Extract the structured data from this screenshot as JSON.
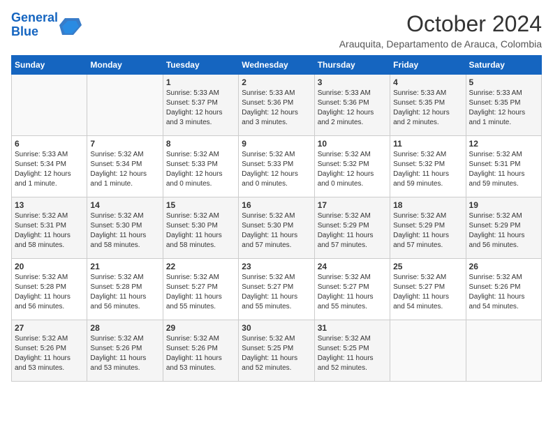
{
  "header": {
    "logo_text_general": "General",
    "logo_text_blue": "Blue",
    "month": "October 2024",
    "location": "Arauquita, Departamento de Arauca, Colombia"
  },
  "weekdays": [
    "Sunday",
    "Monday",
    "Tuesday",
    "Wednesday",
    "Thursday",
    "Friday",
    "Saturday"
  ],
  "weeks": [
    [
      {
        "day": "",
        "info": ""
      },
      {
        "day": "",
        "info": ""
      },
      {
        "day": "1",
        "info": "Sunrise: 5:33 AM\nSunset: 5:37 PM\nDaylight: 12 hours\nand 3 minutes."
      },
      {
        "day": "2",
        "info": "Sunrise: 5:33 AM\nSunset: 5:36 PM\nDaylight: 12 hours\nand 3 minutes."
      },
      {
        "day": "3",
        "info": "Sunrise: 5:33 AM\nSunset: 5:36 PM\nDaylight: 12 hours\nand 2 minutes."
      },
      {
        "day": "4",
        "info": "Sunrise: 5:33 AM\nSunset: 5:35 PM\nDaylight: 12 hours\nand 2 minutes."
      },
      {
        "day": "5",
        "info": "Sunrise: 5:33 AM\nSunset: 5:35 PM\nDaylight: 12 hours\nand 1 minute."
      }
    ],
    [
      {
        "day": "6",
        "info": "Sunrise: 5:33 AM\nSunset: 5:34 PM\nDaylight: 12 hours\nand 1 minute."
      },
      {
        "day": "7",
        "info": "Sunrise: 5:32 AM\nSunset: 5:34 PM\nDaylight: 12 hours\nand 1 minute."
      },
      {
        "day": "8",
        "info": "Sunrise: 5:32 AM\nSunset: 5:33 PM\nDaylight: 12 hours\nand 0 minutes."
      },
      {
        "day": "9",
        "info": "Sunrise: 5:32 AM\nSunset: 5:33 PM\nDaylight: 12 hours\nand 0 minutes."
      },
      {
        "day": "10",
        "info": "Sunrise: 5:32 AM\nSunset: 5:32 PM\nDaylight: 12 hours\nand 0 minutes."
      },
      {
        "day": "11",
        "info": "Sunrise: 5:32 AM\nSunset: 5:32 PM\nDaylight: 11 hours\nand 59 minutes."
      },
      {
        "day": "12",
        "info": "Sunrise: 5:32 AM\nSunset: 5:31 PM\nDaylight: 11 hours\nand 59 minutes."
      }
    ],
    [
      {
        "day": "13",
        "info": "Sunrise: 5:32 AM\nSunset: 5:31 PM\nDaylight: 11 hours\nand 58 minutes."
      },
      {
        "day": "14",
        "info": "Sunrise: 5:32 AM\nSunset: 5:30 PM\nDaylight: 11 hours\nand 58 minutes."
      },
      {
        "day": "15",
        "info": "Sunrise: 5:32 AM\nSunset: 5:30 PM\nDaylight: 11 hours\nand 58 minutes."
      },
      {
        "day": "16",
        "info": "Sunrise: 5:32 AM\nSunset: 5:30 PM\nDaylight: 11 hours\nand 57 minutes."
      },
      {
        "day": "17",
        "info": "Sunrise: 5:32 AM\nSunset: 5:29 PM\nDaylight: 11 hours\nand 57 minutes."
      },
      {
        "day": "18",
        "info": "Sunrise: 5:32 AM\nSunset: 5:29 PM\nDaylight: 11 hours\nand 57 minutes."
      },
      {
        "day": "19",
        "info": "Sunrise: 5:32 AM\nSunset: 5:29 PM\nDaylight: 11 hours\nand 56 minutes."
      }
    ],
    [
      {
        "day": "20",
        "info": "Sunrise: 5:32 AM\nSunset: 5:28 PM\nDaylight: 11 hours\nand 56 minutes."
      },
      {
        "day": "21",
        "info": "Sunrise: 5:32 AM\nSunset: 5:28 PM\nDaylight: 11 hours\nand 56 minutes."
      },
      {
        "day": "22",
        "info": "Sunrise: 5:32 AM\nSunset: 5:27 PM\nDaylight: 11 hours\nand 55 minutes."
      },
      {
        "day": "23",
        "info": "Sunrise: 5:32 AM\nSunset: 5:27 PM\nDaylight: 11 hours\nand 55 minutes."
      },
      {
        "day": "24",
        "info": "Sunrise: 5:32 AM\nSunset: 5:27 PM\nDaylight: 11 hours\nand 55 minutes."
      },
      {
        "day": "25",
        "info": "Sunrise: 5:32 AM\nSunset: 5:27 PM\nDaylight: 11 hours\nand 54 minutes."
      },
      {
        "day": "26",
        "info": "Sunrise: 5:32 AM\nSunset: 5:26 PM\nDaylight: 11 hours\nand 54 minutes."
      }
    ],
    [
      {
        "day": "27",
        "info": "Sunrise: 5:32 AM\nSunset: 5:26 PM\nDaylight: 11 hours\nand 53 minutes."
      },
      {
        "day": "28",
        "info": "Sunrise: 5:32 AM\nSunset: 5:26 PM\nDaylight: 11 hours\nand 53 minutes."
      },
      {
        "day": "29",
        "info": "Sunrise: 5:32 AM\nSunset: 5:26 PM\nDaylight: 11 hours\nand 53 minutes."
      },
      {
        "day": "30",
        "info": "Sunrise: 5:32 AM\nSunset: 5:25 PM\nDaylight: 11 hours\nand 52 minutes."
      },
      {
        "day": "31",
        "info": "Sunrise: 5:32 AM\nSunset: 5:25 PM\nDaylight: 11 hours\nand 52 minutes."
      },
      {
        "day": "",
        "info": ""
      },
      {
        "day": "",
        "info": ""
      }
    ]
  ]
}
